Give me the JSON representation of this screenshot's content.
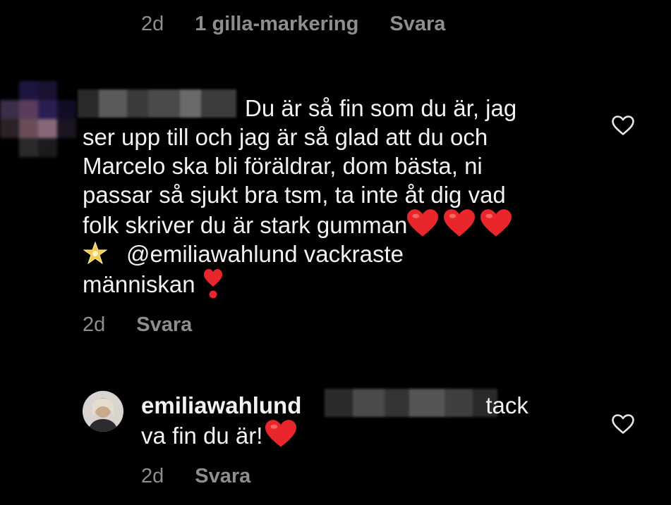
{
  "previous_comment": {
    "time": "2d",
    "likes": "1 gilla-markering",
    "reply_label": "Svara"
  },
  "comment": {
    "lines": [
      "Du är så fin som du är, jag",
      "ser upp till och jag är så glad att du och",
      "Marcelo ska bli föräldrar, dom bästa, ni",
      "passar så sjukt bra tsm, ta inte åt dig vad",
      "folk skriver du är stark gumman",
      "@emiliawahlund vackraste",
      "människan"
    ],
    "time": "2d",
    "reply_label": "Svara",
    "emojis": [
      "red-heart",
      "glowing-star",
      "heavy-heart-exclamation"
    ]
  },
  "reply": {
    "username": "emiliawahlund",
    "text_line_1": "tack",
    "text_line_2": "va fin du är!",
    "time": "2d",
    "reply_label": "Svara"
  },
  "colors": {
    "background": "#000000",
    "text": "#f2f2f2",
    "meta": "#8e8e8e",
    "heart": "#e8262b"
  },
  "icons": [
    "heart-outline-icon",
    "red-heart-emoji",
    "glowing-star-emoji",
    "heavy-heart-exclamation-emoji"
  ]
}
